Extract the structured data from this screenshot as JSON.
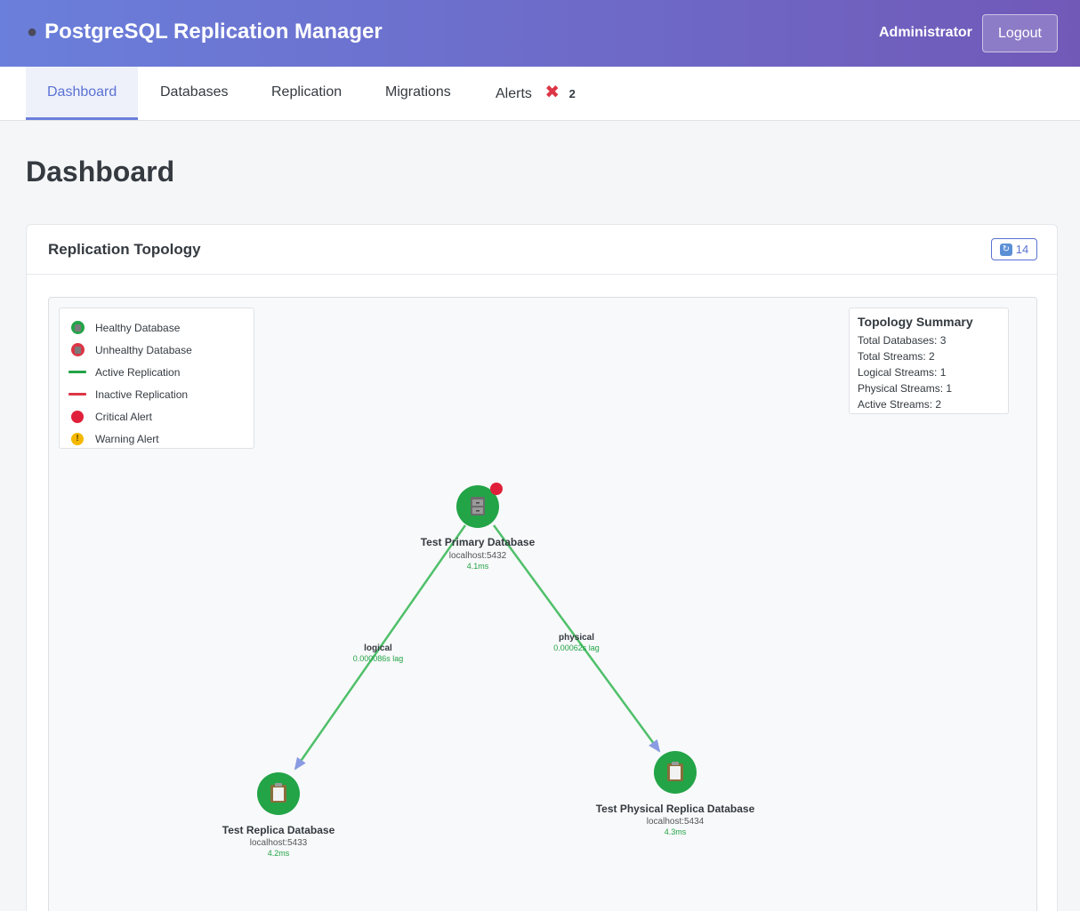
{
  "header": {
    "app_title": "PostgreSQL Replication Manager",
    "app_icon": "elephant-icon",
    "user": "Administrator",
    "logout_label": "Logout"
  },
  "nav": {
    "tabs": [
      {
        "label": "Dashboard",
        "active": true
      },
      {
        "label": "Databases",
        "active": false
      },
      {
        "label": "Replication",
        "active": false
      },
      {
        "label": "Migrations",
        "active": false
      },
      {
        "label": "Alerts",
        "active": false,
        "badge_count": "2",
        "badge_icon": "x-icon"
      }
    ]
  },
  "page": {
    "title": "Dashboard"
  },
  "card": {
    "title": "Replication Topology",
    "refresh_label": "14",
    "refresh_icon": "refresh-icon"
  },
  "legend": {
    "items": [
      {
        "label": "Healthy Database",
        "icon": "healthy-db-icon"
      },
      {
        "label": "Unhealthy Database",
        "icon": "unhealthy-db-icon"
      },
      {
        "label": "Active Replication",
        "icon": "active-line-icon"
      },
      {
        "label": "Inactive Replication",
        "icon": "inactive-line-icon"
      },
      {
        "label": "Critical Alert",
        "icon": "critical-alert-icon"
      },
      {
        "label": "Warning Alert",
        "icon": "warning-alert-icon"
      }
    ]
  },
  "summary": {
    "title": "Topology Summary",
    "rows": [
      "Total Databases: 3",
      "Total Streams: 2",
      "Logical Streams: 1",
      "Physical Streams: 1",
      "Active Streams: 2"
    ]
  },
  "topology": {
    "nodes": [
      {
        "name": "Test Primary Database",
        "host": "localhost:5432",
        "latency": "4.1ms",
        "icon": "file-cabinet-icon",
        "alert": "critical"
      },
      {
        "name": "Test Replica Database",
        "host": "localhost:5433",
        "latency": "4.2ms",
        "icon": "clipboard-icon"
      },
      {
        "name": "Test Physical Replica Database",
        "host": "localhost:5434",
        "latency": "4.3ms",
        "icon": "clipboard-icon"
      }
    ],
    "edges": [
      {
        "type": "logical",
        "lag": "0.000086s lag"
      },
      {
        "type": "physical",
        "lag": "0.00062s lag"
      }
    ]
  },
  "colors": {
    "healthy": "#22a447",
    "unhealthy": "#dc3545",
    "active_line": "#4fc06a",
    "inactive_line": "#dc3545",
    "arrow": "#8a9be3",
    "critical": "#e0203a",
    "warning": "#f5b800",
    "accent": "#5a72d4"
  }
}
